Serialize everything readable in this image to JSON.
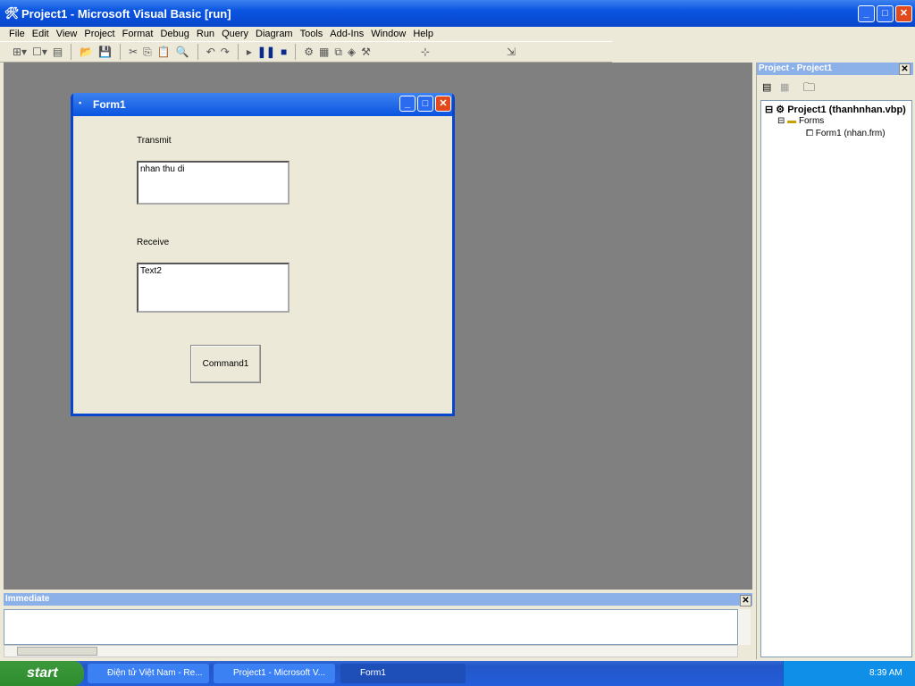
{
  "window": {
    "title": "Project1 - Microsoft Visual Basic [run]"
  },
  "menu": [
    "File",
    "Edit",
    "View",
    "Project",
    "Format",
    "Debug",
    "Run",
    "Query",
    "Diagram",
    "Tools",
    "Add-Ins",
    "Window",
    "Help"
  ],
  "form": {
    "title": "Form1",
    "transmit_label": "Transmit",
    "transmit_value": "nhan thu di",
    "receive_label": "Receive",
    "receive_value": "Text2",
    "command_label": "Command1"
  },
  "project_panel": {
    "title": "Project - Project1",
    "root": "Project1 (thanhnhan.vbp)",
    "folder": "Forms",
    "item": "Form1 (nhan.frm)"
  },
  "immediate": {
    "title": "Immediate"
  },
  "taskbar": {
    "start": "start",
    "tasks": [
      "Điện tử Việt Nam - Re...",
      "Project1 - Microsoft V...",
      "Form1"
    ],
    "clock": "8:39 AM"
  }
}
